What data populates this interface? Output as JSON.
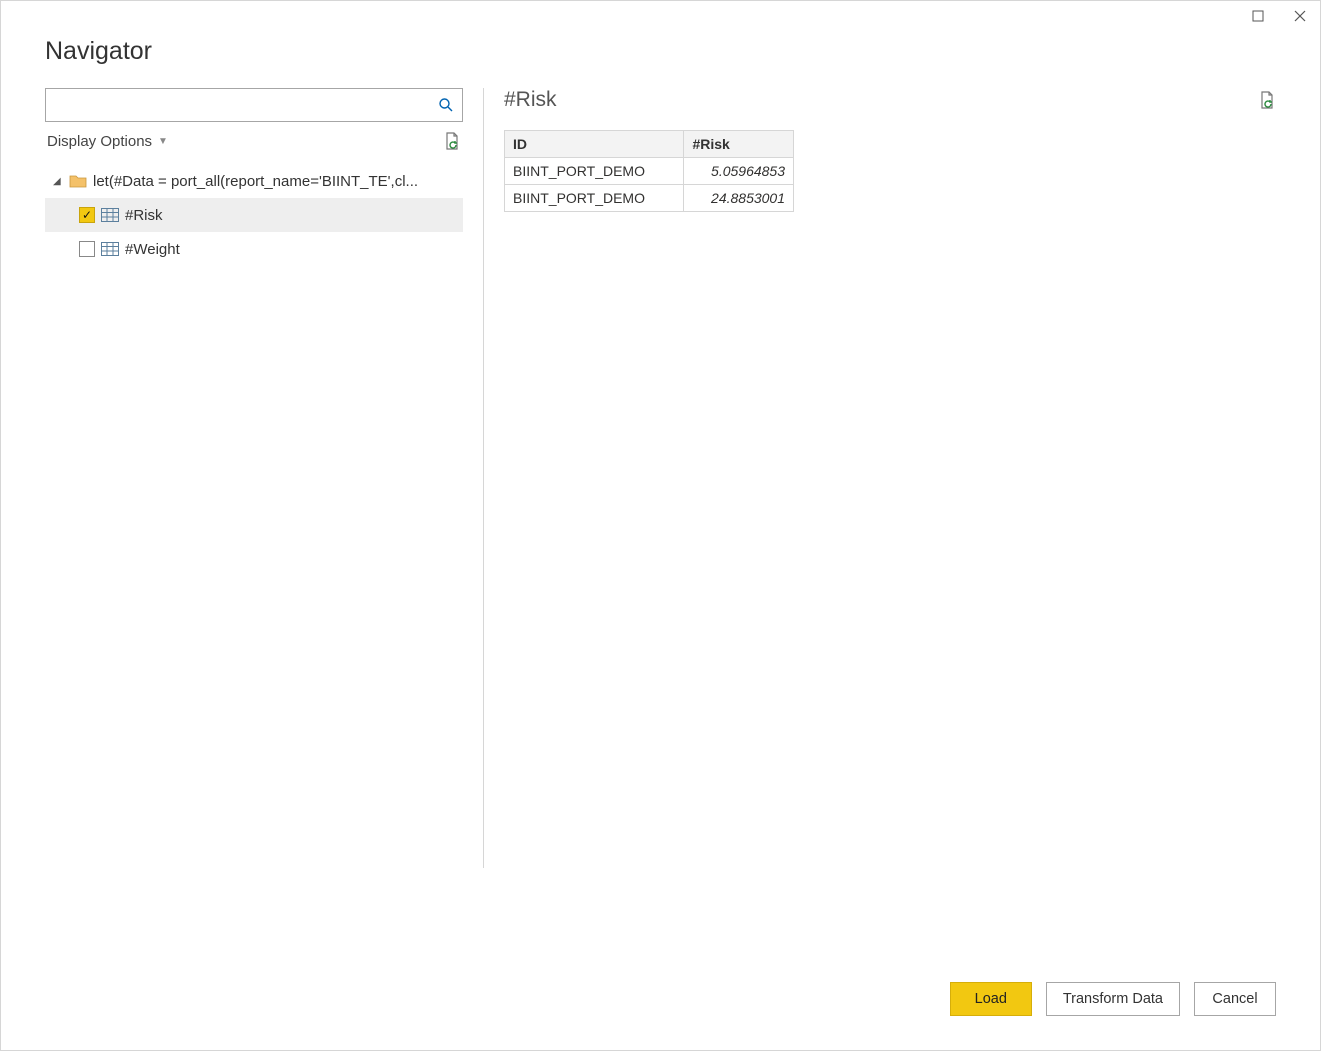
{
  "titlebar": {
    "maximize_tooltip": "Maximize",
    "close_tooltip": "Close"
  },
  "header": {
    "title": "Navigator"
  },
  "left": {
    "search_value": "",
    "display_options_label": "Display Options",
    "refresh_tooltip": "Refresh",
    "tree": {
      "root": {
        "label": "let(#Data = port_all(report_name='BIINT_TE',cl...",
        "expanded": true
      },
      "items": [
        {
          "label": "#Risk",
          "checked": true,
          "selected": true
        },
        {
          "label": "#Weight",
          "checked": false,
          "selected": false
        }
      ]
    }
  },
  "right": {
    "title": "#Risk",
    "refresh_tooltip": "Refresh preview",
    "columns": [
      "ID",
      "#Risk"
    ],
    "rows": [
      {
        "id": "BIINT_PORT_DEMO",
        "risk": "5.05964853"
      },
      {
        "id": "BIINT_PORT_DEMO",
        "risk": "24.8853001"
      }
    ]
  },
  "footer": {
    "load_label": "Load",
    "transform_label": "Transform Data",
    "cancel_label": "Cancel"
  }
}
